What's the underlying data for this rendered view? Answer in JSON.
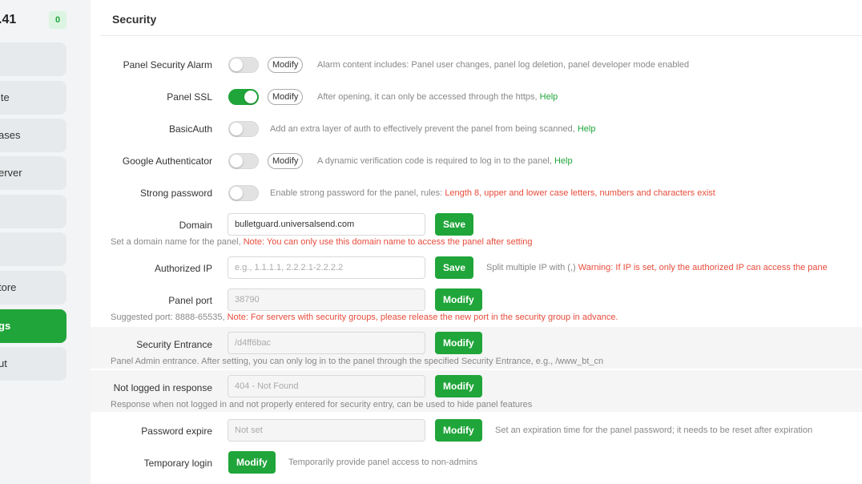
{
  "sidebar": {
    "ip": ".41",
    "badge": "0",
    "items": [
      {
        "label": ""
      },
      {
        "label": "ite"
      },
      {
        "label": "ases"
      },
      {
        "label": "erver"
      },
      {
        "label": ""
      },
      {
        "label": ""
      },
      {
        "label": "tore"
      },
      {
        "label": "gs"
      },
      {
        "label": "ut"
      }
    ]
  },
  "main": {
    "title": "Security",
    "security_alarm": {
      "label": "Panel Security Alarm",
      "modify": "Modify",
      "desc": "Alarm content includes: Panel user changes, panel log deletion, panel developer mode enabled"
    },
    "panel_ssl": {
      "label": "Panel SSL",
      "modify": "Modify",
      "desc": "After opening, it can only be accessed through the https,",
      "help": "Help"
    },
    "basic_auth": {
      "label": "BasicAuth",
      "desc": "Add an extra layer of auth to effectively prevent the panel from being scanned,",
      "help": "Help"
    },
    "google_auth": {
      "label": "Google Authenticator",
      "modify": "Modify",
      "desc": "A dynamic verification code is required to log in to the panel,",
      "help": "Help"
    },
    "strong_password": {
      "label": "Strong password",
      "desc": "Enable strong password for the panel, rules:",
      "rules": "Length 8, upper and lower case letters, numbers and characters exist"
    },
    "domain": {
      "label": "Domain",
      "value": "bulletguard.universalsend.com",
      "save": "Save",
      "sub": "Set a domain name for the panel,",
      "note": "Note: You can only use this domain name to access the panel after setting"
    },
    "authorized_ip": {
      "label": "Authorized IP",
      "placeholder": "e.g., 1.1.1.1, 2.2.2.1-2.2.2.2",
      "save": "Save",
      "desc": "Split multiple IP with (,)",
      "warning": "Warning: If IP is set, only the authorized IP can access the pane"
    },
    "panel_port": {
      "label": "Panel port",
      "value": "38790",
      "modify": "Modify",
      "sub": "Suggested port: 8888-65535,",
      "note": "Note: For servers with security groups, please release the new port in the security group in advance."
    },
    "security_entrance": {
      "label": "Security Entrance",
      "value": "/d4ff6bac",
      "modify": "Modify",
      "sub": "Panel Admin entrance. After setting, you can only log in to the panel through the specified Security Entrance, e.g., /www_bt_cn"
    },
    "not_logged": {
      "label": "Not logged in response",
      "value": "404 - Not Found",
      "modify": "Modify",
      "sub": "Response when not logged in and not properly entered for security entry, can be used to hide panel features"
    },
    "password_expire": {
      "label": "Password expire",
      "value": "Not set",
      "modify": "Modify",
      "desc": "Set an expiration time for the panel password; it needs to be reset after expiration"
    },
    "temp_login": {
      "label": "Temporary login",
      "modify": "Modify",
      "desc": "Temporarily provide panel access to non-admins"
    }
  }
}
